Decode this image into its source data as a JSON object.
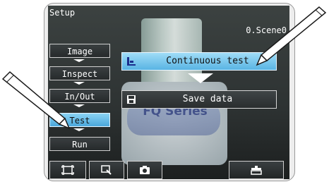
{
  "screen": {
    "title": "Setup",
    "scene": "0.Scene0"
  },
  "nav": {
    "items": [
      {
        "label": "Image",
        "active": false
      },
      {
        "label": "Inspect",
        "active": false
      },
      {
        "label": "In/Out",
        "active": false
      },
      {
        "label": "Test",
        "active": true
      },
      {
        "label": "Run",
        "active": false
      }
    ]
  },
  "menu": {
    "continuous_test": {
      "label": "Continuous test",
      "icon": "test-chart-icon",
      "selected": true
    },
    "save_data": {
      "label": "Save data",
      "icon": "save-disk-icon",
      "selected": false
    }
  },
  "camera_image": {
    "label_text": "FQ Series"
  },
  "toolbar": {
    "buttons": [
      {
        "icon": "frame-fit-icon"
      },
      {
        "icon": "zoom-icon"
      },
      {
        "icon": "camera-icon"
      },
      {
        "icon": "tools-icon"
      }
    ]
  },
  "colors": {
    "selected_button": "#59b4e3",
    "screen_background": "#2a2d2d",
    "text": "#ffffff"
  }
}
